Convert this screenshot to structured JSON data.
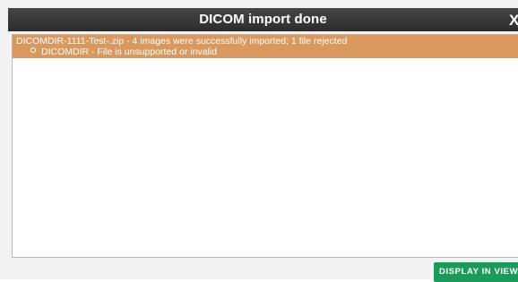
{
  "dialog": {
    "title": "DICOM import done",
    "close_label": "X"
  },
  "result": {
    "summary": "DICOMDIR-1111-Test-.zip - 4 images were successfully imported; 1 file rejected",
    "rejected_items": [
      "DICOMDIR - File is unsupported or invalid"
    ],
    "highlight_color": "#d8985e"
  },
  "actions": {
    "display_label": "DISPLAY IN VIEWER",
    "display_color": "#1c9a5c"
  }
}
